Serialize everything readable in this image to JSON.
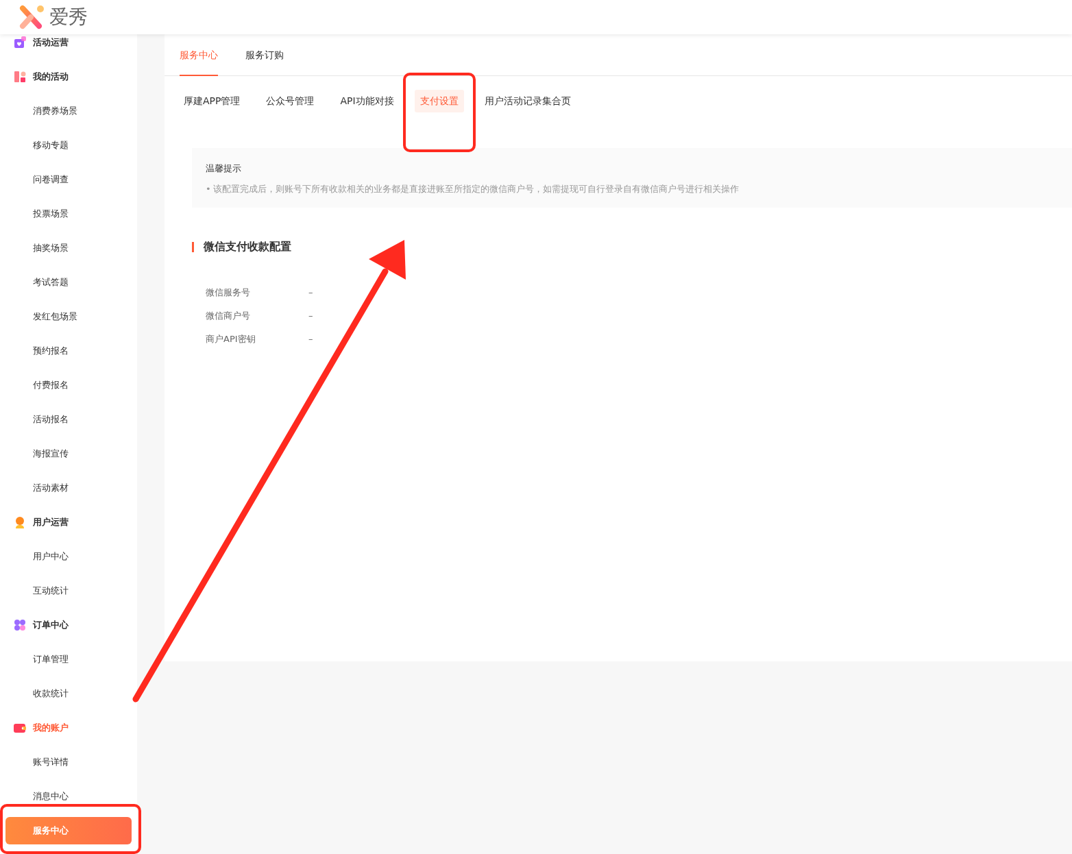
{
  "header": {
    "logo_text": "爱秀"
  },
  "sidebar": {
    "groups": [
      {
        "label": "活动运营",
        "active": false
      },
      {
        "label": "我的活动",
        "active": false,
        "children": [
          {
            "label": "消费券场景",
            "selected": false
          },
          {
            "label": "移动专题",
            "selected": false
          },
          {
            "label": "问卷调查",
            "selected": false
          },
          {
            "label": "投票场景",
            "selected": false
          },
          {
            "label": "抽奖场景",
            "selected": false
          },
          {
            "label": "考试答题",
            "selected": false
          },
          {
            "label": "发红包场景",
            "selected": false
          },
          {
            "label": "预约报名",
            "selected": false
          },
          {
            "label": "付费报名",
            "selected": false
          },
          {
            "label": "活动报名",
            "selected": false
          },
          {
            "label": "海报宣传",
            "selected": false
          },
          {
            "label": "活动素材",
            "selected": false
          }
        ]
      },
      {
        "label": "用户运营",
        "active": false,
        "children": [
          {
            "label": "用户中心",
            "selected": false
          },
          {
            "label": "互动统计",
            "selected": false
          }
        ]
      },
      {
        "label": "订单中心",
        "active": false,
        "children": [
          {
            "label": "订单管理",
            "selected": false
          },
          {
            "label": "收款统计",
            "selected": false
          }
        ]
      },
      {
        "label": "我的账户",
        "active": true,
        "children": [
          {
            "label": "账号详情",
            "selected": false
          },
          {
            "label": "消息中心",
            "selected": false
          },
          {
            "label": "服务中心",
            "selected": true
          }
        ]
      }
    ]
  },
  "tabs": [
    {
      "label": "服务中心",
      "selected": true
    },
    {
      "label": "服务订购",
      "selected": false
    }
  ],
  "sub_tabs": [
    {
      "label": "厚建APP管理",
      "selected": false
    },
    {
      "label": "公众号管理",
      "selected": false
    },
    {
      "label": "API功能对接",
      "selected": false
    },
    {
      "label": "支付设置",
      "selected": true
    },
    {
      "label": "用户活动记录集合页",
      "selected": false
    }
  ],
  "notice": {
    "title": "温馨提示",
    "bullet": "•",
    "items": [
      "该配置完成后，则账号下所有收款相关的业务都是直接进账至所指定的微信商户号，如需提现可自行登录自有微信商户号进行相关操作"
    ]
  },
  "section": {
    "title": "微信支付收款配置",
    "fields": [
      {
        "label": "微信服务号",
        "value": "–"
      },
      {
        "label": "微信商户号",
        "value": "–"
      },
      {
        "label": "商户API密钥",
        "value": "–"
      }
    ]
  },
  "annotations": [
    {
      "kind": "box"
    },
    {
      "kind": "box"
    },
    {
      "kind": "arrow"
    }
  ]
}
